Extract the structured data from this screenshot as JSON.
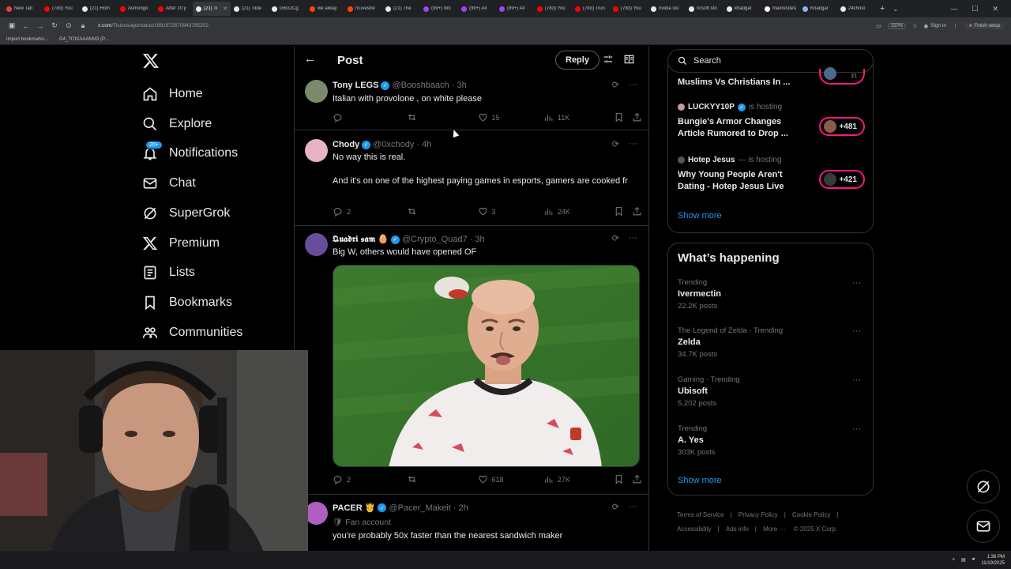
{
  "browser": {
    "tabs": [
      {
        "label": "New Tab",
        "color": "#ea4335"
      },
      {
        "label": "(783) You",
        "color": "#ff0000"
      },
      {
        "label": "(21) Hom",
        "color": "#e7e9ea"
      },
      {
        "label": "Asmongo",
        "color": "#ff0000"
      },
      {
        "label": "After 10 y",
        "color": "#ff0000"
      },
      {
        "label": "(21) Ti",
        "color": "#e7e9ea",
        "active": true
      },
      {
        "label": "(21) Tilde",
        "color": "#e7e9ea"
      },
      {
        "label": "G6G2Cg",
        "color": "#e7e9ea"
      },
      {
        "label": "we alway",
        "color": "#ff4500"
      },
      {
        "label": "r/Livestre",
        "color": "#ff4500"
      },
      {
        "label": "(21) The",
        "color": "#e7e9ea"
      },
      {
        "label": "(99+) Wo",
        "color": "#a142f4"
      },
      {
        "label": "(99+) All",
        "color": "#a142f4"
      },
      {
        "label": "(99+) All",
        "color": "#a142f4"
      },
      {
        "label": "(783) You",
        "color": "#ff0000"
      },
      {
        "label": "(783) Trun",
        "color": "#ff0000"
      },
      {
        "label": "(783) You",
        "color": "#ff0000"
      },
      {
        "label": "nvidia sto",
        "color": "#e8eaed"
      },
      {
        "label": "ncsoft sto",
        "color": "#e8eaed"
      },
      {
        "label": "khadgar",
        "color": "#e8eaed"
      },
      {
        "label": "maxresdefault",
        "color": "#ffffff"
      },
      {
        "label": "Khadgar",
        "color": "#8ab4f8"
      },
      {
        "label": "24christ",
        "color": "#e8eaed"
      }
    ],
    "url_prefix": "x.com",
    "url_path": "/Ticiousogo/status/1991072670943785252",
    "zoom": "150%",
    "sign_in": "Sign in",
    "finish_setup": "Finish setup",
    "bookmarks": [
      "Import bookmarks...",
      "G4_7t7tXAAAfvM3 (P..."
    ]
  },
  "nav": {
    "items": [
      {
        "label": "Home",
        "icon": "home-icon"
      },
      {
        "label": "Explore",
        "icon": "search-icon"
      },
      {
        "label": "Notifications",
        "icon": "bell-icon",
        "badge": "20+"
      },
      {
        "label": "Chat",
        "icon": "mail-icon"
      },
      {
        "label": "SuperGrok",
        "icon": "grok-icon"
      },
      {
        "label": "Premium",
        "icon": "x-icon"
      },
      {
        "label": "Lists",
        "icon": "list-icon"
      },
      {
        "label": "Bookmarks",
        "icon": "bookmark-icon"
      },
      {
        "label": "Communities",
        "icon": "communities-icon"
      }
    ]
  },
  "header": {
    "title": "Post",
    "reply_label": "Reply"
  },
  "tweets": [
    {
      "name": "Tony LEGS",
      "handle": "@Booshbaach",
      "time": "· 3h",
      "text": "Italian with provolone , on white please",
      "replies": "",
      "retweets": "",
      "likes": "15",
      "views": "11K",
      "avatar_color": "#7a8a6a"
    },
    {
      "name": "Chody",
      "handle": "@0xchody",
      "time": "· 4h",
      "text": "No way this is real.",
      "text2": "And it's on one of the highest paying games in esports, gamers are cooked fr",
      "replies": "2",
      "retweets": "",
      "likes": "3",
      "views": "24K",
      "avatar_color": "#e9b3c4"
    },
    {
      "name": "𝕼𝖚𝖆𝖉𝖗𝖎 𝖘𝖆𝖒 🥚",
      "handle": "@Crypto_Quad7",
      "time": "· 3h",
      "text": "Big W, others would have opened OF",
      "replies": "2",
      "retweets": "",
      "likes": "618",
      "views": "27K",
      "avatar_color": "#6a4c9c"
    },
    {
      "name": "PACER 🤴",
      "handle": "@Pacer_Makeit",
      "time": "· 2h",
      "fan": "🛡 Fan account",
      "text": "you're probably 50x faster than the nearest sandwich maker",
      "avatar_color": "#b05fc0"
    }
  ],
  "search": {
    "placeholder": "Search"
  },
  "spaces": {
    "items": [
      {
        "title": "Muslims Vs Christians In ...",
        "count": "21"
      },
      {
        "host": "LUCKYY10P",
        "hosting": "is hosting",
        "title": "Bungie's Armor Changes Article Rumored to Drop ...",
        "count": "+481"
      },
      {
        "host": "Hotep Jesus",
        "hosting": "— is hosting",
        "title": "Why Young People Aren't Dating - Hotep Jesus Live",
        "count": "+421"
      }
    ],
    "show_more": "Show more"
  },
  "happening": {
    "title": "What’s happening",
    "trends": [
      {
        "category": "Trending",
        "name": "Ivermectin",
        "posts": "22.2K posts"
      },
      {
        "category": "The Legend of Zelda · Trending",
        "name": "Zelda",
        "posts": "34.7K posts"
      },
      {
        "category": "Gaming · Trending",
        "name": "Ubisoft",
        "posts": "5,202 posts"
      },
      {
        "category": "Trending",
        "name": "A. Yes",
        "posts": "303K posts"
      }
    ],
    "show_more": "Show more"
  },
  "footer": {
    "links": [
      "Terms of Service",
      "Privacy Policy",
      "Cookie Policy",
      "Accessibility",
      "Ads info",
      "More ···",
      "© 2025 X Corp."
    ]
  },
  "taskbar": {
    "time": "1:36 PM",
    "date": "11/19/2025"
  },
  "colors": {
    "accent": "#1d9bf0",
    "live_pill": "#f91880"
  }
}
